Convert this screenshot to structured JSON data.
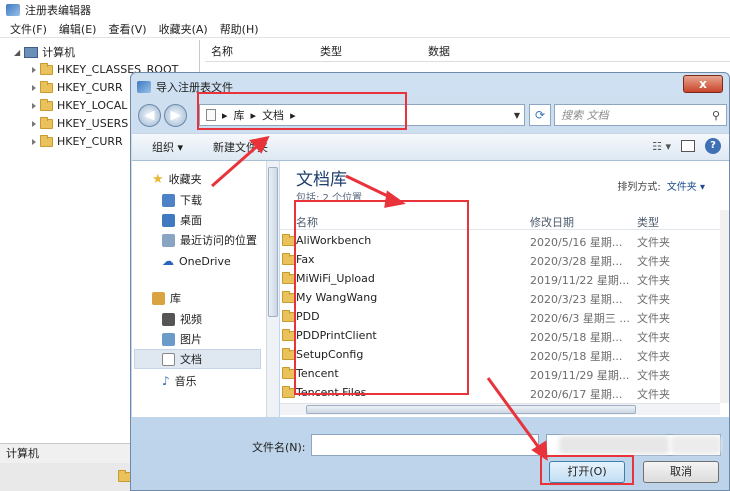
{
  "regedit": {
    "title": "注册表编辑器",
    "menu": [
      "文件(F)",
      "编辑(E)",
      "查看(V)",
      "收藏夹(A)",
      "帮助(H)"
    ],
    "tree_root": "计算机",
    "tree_items": [
      "HKEY_CLASSES_ROOT",
      "HKEY_CURR",
      "HKEY_LOCAL",
      "HKEY_USERS",
      "HKEY_CURR"
    ],
    "columns": [
      "名称",
      "类型",
      "数据"
    ],
    "status": "计算机"
  },
  "dialog": {
    "title": "导入注册表文件",
    "close": "x",
    "address": [
      "库",
      "文档"
    ],
    "search_placeholder": "搜索 文档",
    "toolbar": {
      "organize": "组织 ▾",
      "new_folder": "新建文件夹"
    },
    "nav": {
      "favorites": "收藏夹",
      "fav_items": [
        "下载",
        "桌面",
        "最近访问的位置"
      ],
      "onedrive": "OneDrive",
      "libraries": "库",
      "lib_items": [
        "视频",
        "图片",
        "文档",
        "音乐"
      ]
    },
    "library_title": "文档库",
    "library_sub": "包括: 2 个位置",
    "arrange_label": "排列方式:",
    "arrange_value": "文件夹 ▾",
    "columns": {
      "name": "名称",
      "date": "修改日期",
      "type": "类型"
    },
    "files": [
      {
        "name": "AliWorkbench",
        "date": "2020/5/16 星期...",
        "type": "文件夹"
      },
      {
        "name": "Fax",
        "date": "2020/3/28 星期...",
        "type": "文件夹"
      },
      {
        "name": "MiWiFi_Upload",
        "date": "2019/11/22 星期...",
        "type": "文件夹"
      },
      {
        "name": "My WangWang",
        "date": "2020/3/23 星期...",
        "type": "文件夹"
      },
      {
        "name": "PDD",
        "date": "2020/6/3 星期三 ...",
        "type": "文件夹"
      },
      {
        "name": "PDDPrintClient",
        "date": "2020/5/18 星期...",
        "type": "文件夹"
      },
      {
        "name": "SetupConfig",
        "date": "2020/5/18 星期...",
        "type": "文件夹"
      },
      {
        "name": "Tencent",
        "date": "2019/11/29 星期...",
        "type": "文件夹"
      },
      {
        "name": "Tencent Files",
        "date": "2020/6/17 星期...",
        "type": "文件夹"
      }
    ],
    "filename_label": "文件名(N):",
    "filename_value": "",
    "open_button": "打开(O)",
    "cancel_button": "取消"
  },
  "colors": {
    "annotation": "#e8333a",
    "title_blue": "#1e3f6e",
    "folder": "#e9c25c"
  }
}
